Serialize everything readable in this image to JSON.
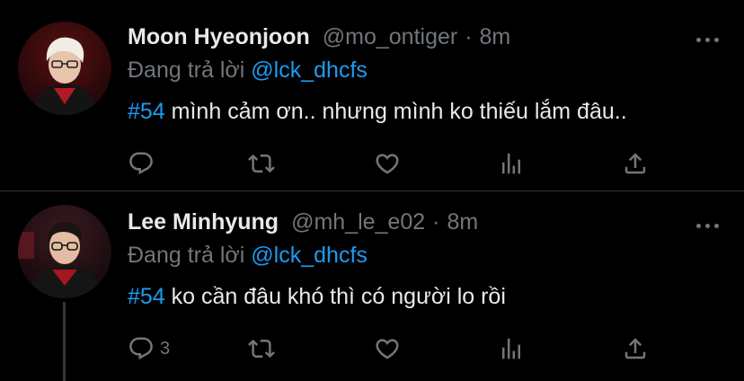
{
  "tweets": [
    {
      "name": "Moon Hyeonjoon",
      "handle": "@mo_ontiger",
      "separator": "·",
      "time": "8m",
      "replying_prefix": "Đang trả lời",
      "replying_to": "@lck_dhcfs",
      "hashtag": "#54",
      "text": " mình cảm ơn.. nhưng mình ko thiếu lắm đâu..",
      "reply_count": ""
    },
    {
      "name": "Lee Minhyung",
      "handle": "@mh_le_e02",
      "separator": "·",
      "time": "8m",
      "replying_prefix": "Đang trả lời",
      "replying_to": "@lck_dhcfs",
      "hashtag": "#54",
      "text": " ko cần đâu khó thì có người lo rồi",
      "reply_count": "3"
    }
  ],
  "colors": {
    "background": "#000000",
    "primary_text": "#e7e9ea",
    "secondary_text": "#71767b",
    "accent": "#1d9bf0",
    "divider": "#2f3336"
  },
  "icons": [
    "reply-icon",
    "retweet-icon",
    "like-icon",
    "analytics-icon",
    "share-icon",
    "more-icon"
  ]
}
